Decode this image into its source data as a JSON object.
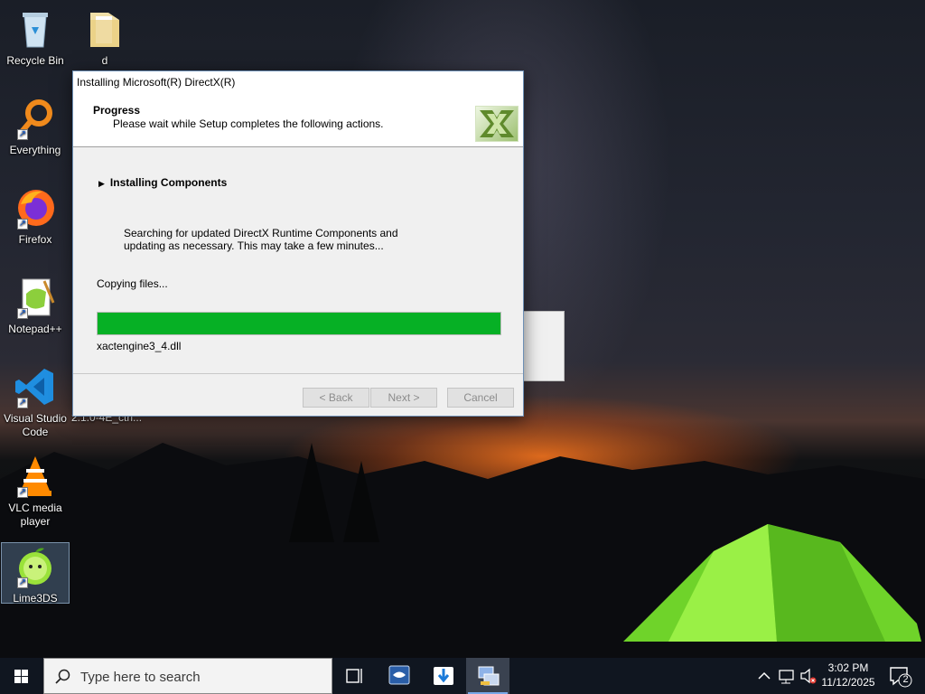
{
  "desktop": {
    "icons": [
      {
        "label": "Recycle Bin",
        "icon": "recycle-bin-icon"
      },
      {
        "label": "d",
        "icon": "folder-icon"
      },
      {
        "label": "Everything",
        "icon": "everything-search-icon"
      },
      {
        "label": "Firefox",
        "icon": "firefox-icon"
      },
      {
        "label": "Notepad++",
        "icon": "notepad-plus-plus-icon"
      },
      {
        "label": "Visual Studio Code",
        "icon": "vscode-icon"
      },
      {
        "label": "VLC media player",
        "icon": "vlc-icon"
      },
      {
        "label": "Lime3DS",
        "icon": "lime3ds-icon"
      }
    ],
    "background_window_caption": "2.1.0-4E_ctrl..."
  },
  "dialog": {
    "title": "Installing Microsoft(R) DirectX(R)",
    "header_title": "Progress",
    "header_subtitle": "Please wait while Setup completes the following actions.",
    "section_heading": "Installing Components",
    "description": "Searching for updated DirectX Runtime Components and updating as necessary. This may take a few minutes...",
    "status": "Copying files...",
    "progress_fraction": 1.0,
    "progress_color": "#06b025",
    "current_file": "xactengine3_4.dll",
    "buttons": {
      "back": "< Back",
      "next": "Next >",
      "cancel": "Cancel"
    }
  },
  "taskbar": {
    "search_placeholder": "Type here to search",
    "pinned": [
      "task-view-icon",
      "app-blue-icon",
      "installer-download-icon",
      "directx-setup-icon"
    ],
    "clock": {
      "time": "3:02 PM",
      "date": "11/12/2025"
    },
    "notification_count": "2"
  }
}
